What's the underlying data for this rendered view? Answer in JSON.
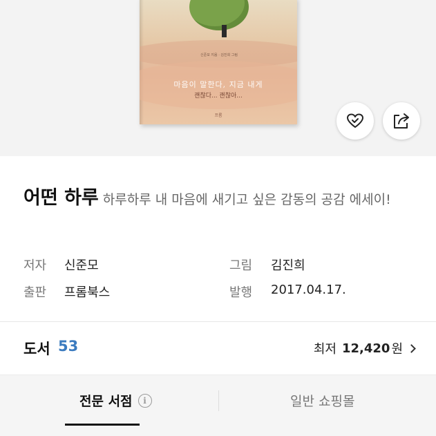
{
  "cover": {
    "title_text": "마음이 말한다, 지금 내게",
    "subtitle_text": "괜찮다... 괜찮아...",
    "authors_text": "신준모 지음 · 김진희 그림",
    "publisher_logo_text": "프롬"
  },
  "actions": {
    "like_icon": "heart-icon",
    "share_icon": "share-icon"
  },
  "book": {
    "title": "어떤 하루",
    "description": "하루하루 내 마음에 새기고 싶은 감동의 공감 에세이!"
  },
  "meta": {
    "author_label": "저자",
    "author_value": "신준모",
    "illustrator_label": "그림",
    "illustrator_value": "김진희",
    "publisher_label": "출판",
    "publisher_value": "프롬북스",
    "date_label": "발행",
    "date_value": "2017.04.17."
  },
  "offers": {
    "label": "도서",
    "count": "53",
    "lowest_label": "최저",
    "lowest_price": "12,420",
    "currency": "원"
  },
  "tabs": [
    {
      "label": "전문 서점",
      "active": true
    },
    {
      "label": "일반 쇼핑몰",
      "active": false
    }
  ],
  "colors": {
    "accent_count": "#3b7bbf",
    "tab_bg": "#f5f5f5"
  }
}
